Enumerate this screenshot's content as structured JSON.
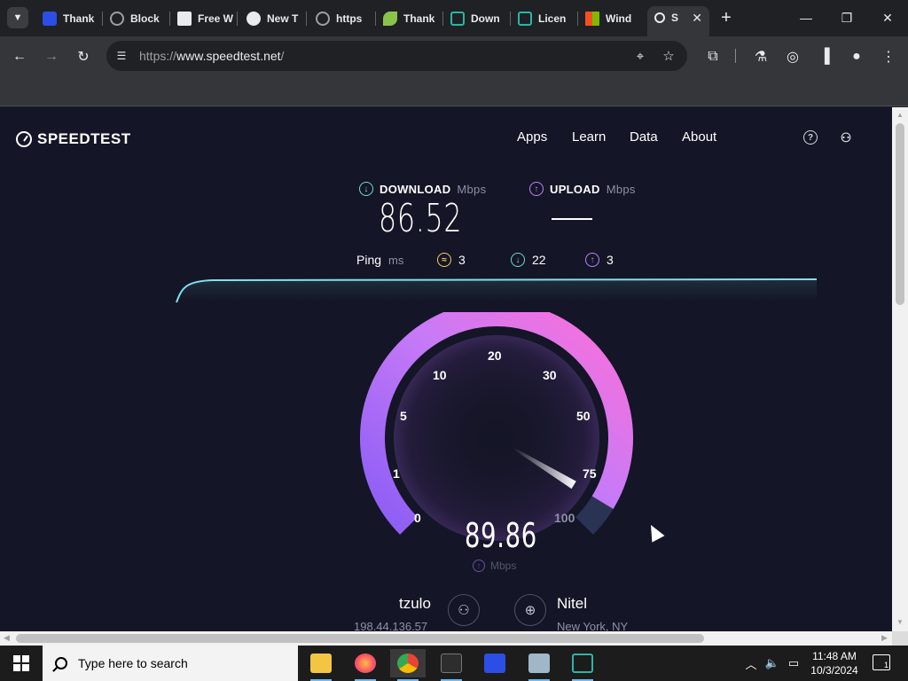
{
  "browser": {
    "tabs": [
      {
        "label": "Thank",
        "favicon": "malwarebytes-icon",
        "color": "#2c4ee6"
      },
      {
        "label": "Block",
        "favicon": "globe-icon",
        "color": "#9aa0a6"
      },
      {
        "label": "Free W",
        "favicon": "image-icon",
        "color": "#e8eaed"
      },
      {
        "label": "New T",
        "favicon": "globe-icon",
        "color": "#e8eaed"
      },
      {
        "label": "https",
        "favicon": "globe-icon",
        "color": "#9aa0a6"
      },
      {
        "label": "Thank",
        "favicon": "leaf-icon",
        "color": "#8bc34a"
      },
      {
        "label": "Down",
        "favicon": "vb-icon",
        "color": "#2bb5a6"
      },
      {
        "label": "Licen",
        "favicon": "vb-icon",
        "color": "#2bb5a6"
      },
      {
        "label": "Wind",
        "favicon": "windows-icon",
        "color": "#f25022"
      },
      {
        "label": "S",
        "favicon": "speedtest-icon",
        "color": "#e8eaed"
      }
    ],
    "new_tab_label": "+",
    "url_scheme": "https://",
    "url_host": "www.speedtest.net",
    "url_path": "/"
  },
  "page": {
    "logo_text": "SPEEDTEST",
    "nav": [
      "Apps",
      "Learn",
      "Data",
      "About"
    ],
    "download": {
      "label": "DOWNLOAD",
      "unit": "Mbps",
      "value": "86.52"
    },
    "upload": {
      "label": "UPLOAD",
      "unit": "Mbps",
      "value": ""
    },
    "ping": {
      "label": "Ping",
      "unit": "ms",
      "idle": "3",
      "down": "22",
      "up": "3"
    },
    "gauge": {
      "ticks": [
        "0",
        "1",
        "5",
        "10",
        "20",
        "30",
        "50",
        "75",
        "100"
      ],
      "current_value": "89.86",
      "unit": "Mbps",
      "needle_value": 89.86
    },
    "client": {
      "name": "tzulo",
      "ip": "198.44.136.57"
    },
    "server": {
      "name": "Nitel",
      "location": "New York, NY"
    }
  },
  "taskbar": {
    "search_placeholder": "Type here to search",
    "apps": [
      "file-explorer-icon",
      "firefox-icon",
      "chrome-icon",
      "terminal-icon",
      "malwarebytes-icon",
      "remote-desktop-icon",
      "vb-icon"
    ],
    "time": "11:48 AM",
    "date": "10/3/2024",
    "notification_count": "1"
  },
  "colors": {
    "page_bg": "#141526",
    "download_accent": "#6fdcd2",
    "upload_accent": "#c084ff",
    "gauge_start": "#8a5cf5",
    "gauge_end": "#ff6fd8"
  }
}
